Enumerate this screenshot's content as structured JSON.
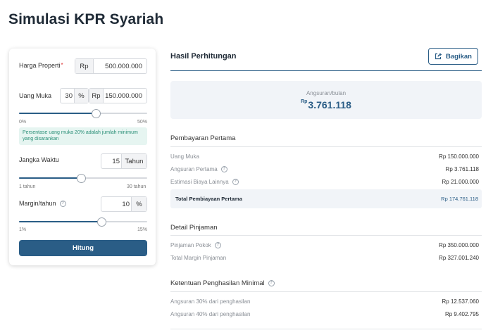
{
  "page": {
    "title": "Simulasi KPR Syariah"
  },
  "form": {
    "harga_properti": {
      "label": "Harga Properti",
      "required_mark": "*",
      "prefix": "Rp",
      "value": "500.000.000"
    },
    "uang_muka": {
      "label": "Uang Muka",
      "percent_value": "30",
      "percent_symbol": "%",
      "prefix": "Rp",
      "value": "150.000.000",
      "slider": {
        "min_label": "0%",
        "max_label": "50%",
        "level_fraction": 0.6
      }
    },
    "hint": "Persentase uang muka 20% adalah jumlah minimum yang disarankan",
    "jangka_waktu": {
      "label": "Jangka Waktu",
      "value": "15",
      "suffix": "Tahun",
      "slider": {
        "min_label": "1 tahun",
        "max_label": "30 tahun",
        "level_fraction": 0.483
      }
    },
    "margin": {
      "label": "Margin/tahun",
      "value": "10",
      "suffix": "%",
      "slider": {
        "min_label": "1%",
        "max_label": "15%",
        "level_fraction": 0.643
      }
    },
    "submit_label": "Hitung"
  },
  "result": {
    "title": "Hasil Perhitungan",
    "share_label": "Bagikan",
    "installment": {
      "label": "Angsuran/bulan",
      "currency": "Rp",
      "value": "3.761.118"
    },
    "pembayaran_pertama": {
      "title": "Pembayaran Pertama",
      "rows": [
        {
          "label": "Uang Muka",
          "value": "Rp 150.000.000"
        },
        {
          "label": "Angsuran Pertama",
          "value": "Rp 3.761.118"
        },
        {
          "label": "Estimasi Biaya Lainnya",
          "value": "Rp 21.000.000"
        }
      ],
      "total": {
        "label": "Total Pembiayaan Pertama",
        "value": "Rp 174.761.118"
      }
    },
    "detail_pinjaman": {
      "title": "Detail Pinjaman",
      "rows": [
        {
          "label": "Pinjaman Pokok",
          "value": "Rp 350.000.000"
        },
        {
          "label": "Total Margin Pinjaman",
          "value": "Rp 327.001.240"
        }
      ]
    },
    "penghasilan_minimal": {
      "title": "Ketentuan Penghasilan Minimal",
      "rows": [
        {
          "label": "Angsuran 30% dari penghasilan",
          "value": "Rp 12.537.060"
        },
        {
          "label": "Angsuran 40% dari penghasilan",
          "value": "Rp 9.402.795"
        }
      ]
    }
  },
  "icons": {
    "info": "info-circle-icon",
    "share": "share-icon"
  },
  "colors": {
    "primary": "#2a5d86",
    "hint_bg": "#e6f5f1",
    "hint_text": "#2a8f77",
    "panel_bg": "#f1f4f8"
  }
}
